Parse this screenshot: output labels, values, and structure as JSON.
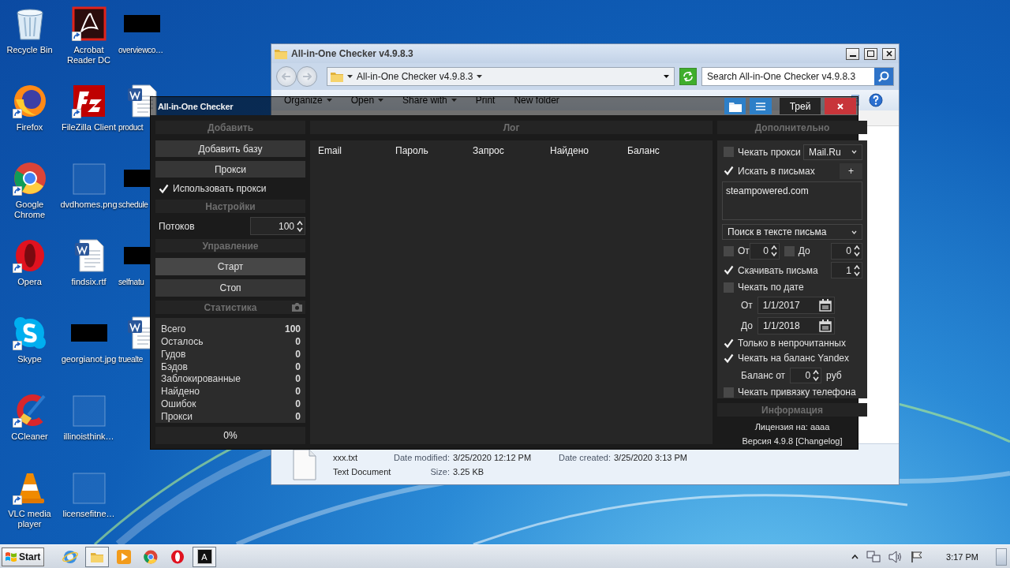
{
  "desktop_icons": [
    {
      "label": "Recycle Bin",
      "kind": "recycle",
      "shortcut": false
    },
    {
      "label": "Firefox",
      "kind": "firefox",
      "shortcut": true
    },
    {
      "label": "Google Chrome",
      "kind": "chrome",
      "shortcut": true
    },
    {
      "label": "Opera",
      "kind": "opera",
      "shortcut": true
    },
    {
      "label": "Skype",
      "kind": "skype",
      "shortcut": true
    },
    {
      "label": "CCleaner",
      "kind": "ccleaner",
      "shortcut": true
    },
    {
      "label": "VLC media player",
      "kind": "vlc",
      "shortcut": true
    },
    {
      "label": "Acrobat Reader DC",
      "kind": "acrobat",
      "shortcut": true
    },
    {
      "label": "FileZilla Client",
      "kind": "filezilla",
      "shortcut": true
    },
    {
      "label": "dvdhomes.png",
      "kind": "blank",
      "shortcut": false
    },
    {
      "label": "findsix.rtf",
      "kind": "word",
      "shortcut": false
    },
    {
      "label": "georgianot.jpg",
      "kind": "redacted",
      "shortcut": false
    },
    {
      "label": "illinoisthink…",
      "kind": "blank",
      "shortcut": false
    },
    {
      "label": "licensefitne…",
      "kind": "blank",
      "shortcut": false
    },
    {
      "label": "overviewco…",
      "kind": "redacted",
      "shortcut": false
    },
    {
      "label": "product",
      "kind": "word",
      "shortcut": false
    },
    {
      "label": "schedule",
      "kind": "redacted",
      "shortcut": false
    },
    {
      "label": "selfnatu",
      "kind": "redacted",
      "shortcut": false
    },
    {
      "label": "truealte",
      "kind": "word",
      "shortcut": false
    }
  ],
  "explorer": {
    "title": "All-in-One Checker v4.9.8.3",
    "address": "All-in-One Checker v4.9.8.3",
    "search": {
      "placeholder": "Search All-in-One Checker v4.9.8.3"
    },
    "toolbar": [
      {
        "label": "Organize",
        "menu": true
      },
      {
        "label": "Open",
        "menu": true
      },
      {
        "label": "Share with",
        "menu": true
      },
      {
        "label": "Print",
        "menu": false
      },
      {
        "label": "New folder",
        "menu": false
      }
    ],
    "details": {
      "name": "xxx.txt",
      "type": "Text Document",
      "modified_label": "Date modified:",
      "modified": "3/25/2020 12:12 PM",
      "size_label": "Size:",
      "size": "3.25 KB",
      "created_label": "Date created:",
      "created": "3/25/2020 3:13 PM"
    }
  },
  "app": {
    "title": "All-in-One Checker",
    "title_buttons": [
      {
        "kind": "folder"
      },
      {
        "kind": "menu"
      },
      {
        "kind": "text",
        "label": "Трей"
      },
      {
        "kind": "close"
      }
    ],
    "left": {
      "add_header": "Добавить",
      "add_base": "Добавить базу",
      "proxy_button": "Прокси",
      "use_proxy": {
        "label": "Использовать прокси",
        "checked": true
      },
      "settings_header": "Настройки",
      "threads": {
        "label": "Потоков",
        "value": "100"
      },
      "control_header": "Управление",
      "control_buttons": [
        {
          "label": "Старт",
          "highlighted": true
        },
        {
          "label": "Стоп",
          "highlighted": false
        }
      ],
      "stats_header": "Статистика",
      "stats": [
        {
          "label": "Всего",
          "value": "100"
        },
        {
          "label": "Осталось",
          "value": "0"
        },
        {
          "label": "Гудов",
          "value": "0"
        },
        {
          "label": "Бэдов",
          "value": "0"
        },
        {
          "label": "Заблокированные",
          "value": "0"
        },
        {
          "label": "Найдено",
          "value": "0"
        },
        {
          "label": "Ошибок",
          "value": "0"
        },
        {
          "label": "Прокси",
          "value": "0"
        }
      ],
      "progress": "0%"
    },
    "log": {
      "header": "Лог",
      "columns": [
        "Email",
        "Пароль",
        "Запрос",
        "Найдено",
        "Баланс"
      ]
    },
    "right": {
      "extra_header": "Дополнительно",
      "check_proxy": {
        "label": "Чекать прокси",
        "checked": false
      },
      "service": "Mail.Ru",
      "search_mail": {
        "label": "Искать в письмах",
        "checked": true
      },
      "add_button": "+",
      "search_terms": "steampowered.com",
      "search_mode": "Поиск в тексте письма",
      "from_count": {
        "label": "От",
        "checked": false,
        "value": "0"
      },
      "to_count": {
        "label": "До",
        "checked": false,
        "value": "0"
      },
      "download": {
        "label": "Скачивать письма",
        "checked": true,
        "value": "1"
      },
      "by_date": {
        "label": "Чекать по дате",
        "checked": false
      },
      "date_from": {
        "label": "От",
        "value": "1/1/2017"
      },
      "date_to": {
        "label": "До",
        "value": "1/1/2018"
      },
      "unread_only": {
        "label": "Только в непрочитанных",
        "checked": true
      },
      "yandex_balance": {
        "label": "Чекать на баланс Yandex",
        "checked": true
      },
      "balance_from": {
        "label": "Баланс от",
        "value": "0",
        "unit": "руб"
      },
      "phone_link": {
        "label": "Чекать привязку телефона",
        "checked": false
      },
      "info_header": "Информация",
      "license": "Лицензия на: аааа",
      "version": "Версия 4.9.8 [Changelog]"
    }
  },
  "taskbar": {
    "start": "Start",
    "apps": [
      {
        "kind": "ie",
        "running": false
      },
      {
        "kind": "explorer",
        "running": true
      },
      {
        "kind": "media",
        "running": false
      },
      {
        "kind": "chrome",
        "running": false
      },
      {
        "kind": "opera",
        "running": false
      },
      {
        "kind": "app",
        "label": "A",
        "running": true
      }
    ],
    "clock": "3:17 PM"
  }
}
